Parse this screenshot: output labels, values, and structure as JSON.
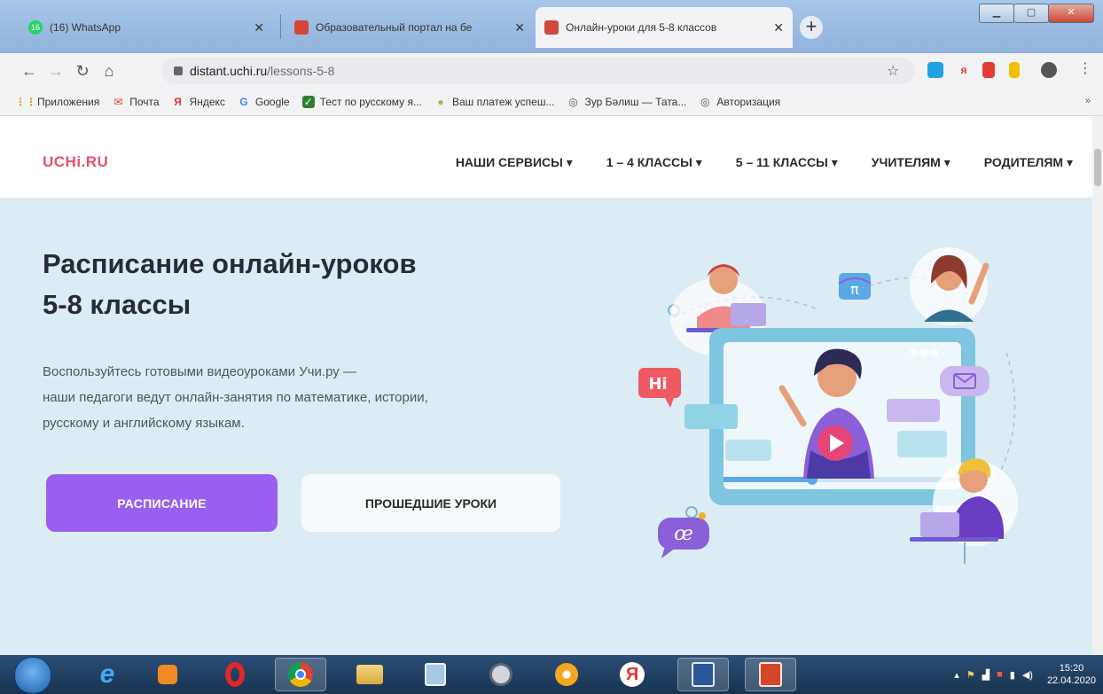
{
  "browser": {
    "tabs": [
      {
        "title": "(16) WhatsApp",
        "badge": "16",
        "favicon": "whatsapp-icon",
        "active": false
      },
      {
        "title": "Образовательный портал на бе",
        "favicon": "portal-icon",
        "active": false
      },
      {
        "title": "Онлайн-уроки для 5-8 классов",
        "favicon": "uchi-icon",
        "active": true
      }
    ],
    "new_tab_label": "+",
    "url_host": "distant.uchi.ru",
    "url_path": "/lessons-5-8",
    "bookmarks": [
      {
        "label": "Приложения",
        "icon": "apps-grid-icon"
      },
      {
        "label": "Почта",
        "icon": "mail-icon"
      },
      {
        "label": "Яндекс",
        "icon": "yandex-icon",
        "glyph": "Я"
      },
      {
        "label": "Google",
        "icon": "google-icon",
        "glyph": "G"
      },
      {
        "label": "Тест по русскому я...",
        "icon": "check-icon"
      },
      {
        "label": "Ваш платеж успеш...",
        "icon": "pin-icon"
      },
      {
        "label": "Зур Бәлиш — Тата...",
        "icon": "globe-icon"
      },
      {
        "label": "Авторизация",
        "icon": "globe-icon"
      }
    ],
    "bookmarks_more": "»"
  },
  "site": {
    "logo": "UCHi.RU",
    "nav": [
      "НАШИ СЕРВИСЫ ▾",
      "1 – 4 КЛАССЫ ▾",
      "5 – 11 КЛАССЫ ▾",
      "УЧИТЕЛЯМ ▾",
      "РОДИТЕЛЯМ ▾"
    ],
    "hero": {
      "title_line1": "Расписание онлайн-уроков",
      "title_line2": "5-8 классы",
      "desc_line1": "Воспользуйтесь готовыми видеоуроками Учи.ру —",
      "desc_line2": "наши педагоги ведут онлайн-занятия по математике, истории,",
      "desc_line3": "русскому и английскому языкам.",
      "primary_button": "РАСПИСАНИЕ",
      "secondary_button": "ПРОШЕДШИЕ УРОКИ"
    },
    "illustration": {
      "hi_label": "Hi",
      "pi_label": "π",
      "oe_label": "œ"
    }
  },
  "taskbar": {
    "time": "15:20",
    "date": "22.04.2020"
  },
  "colors": {
    "brand": "#e84f6e",
    "primary": "#9a5ff0",
    "hero_bg": "#dcecf5"
  }
}
